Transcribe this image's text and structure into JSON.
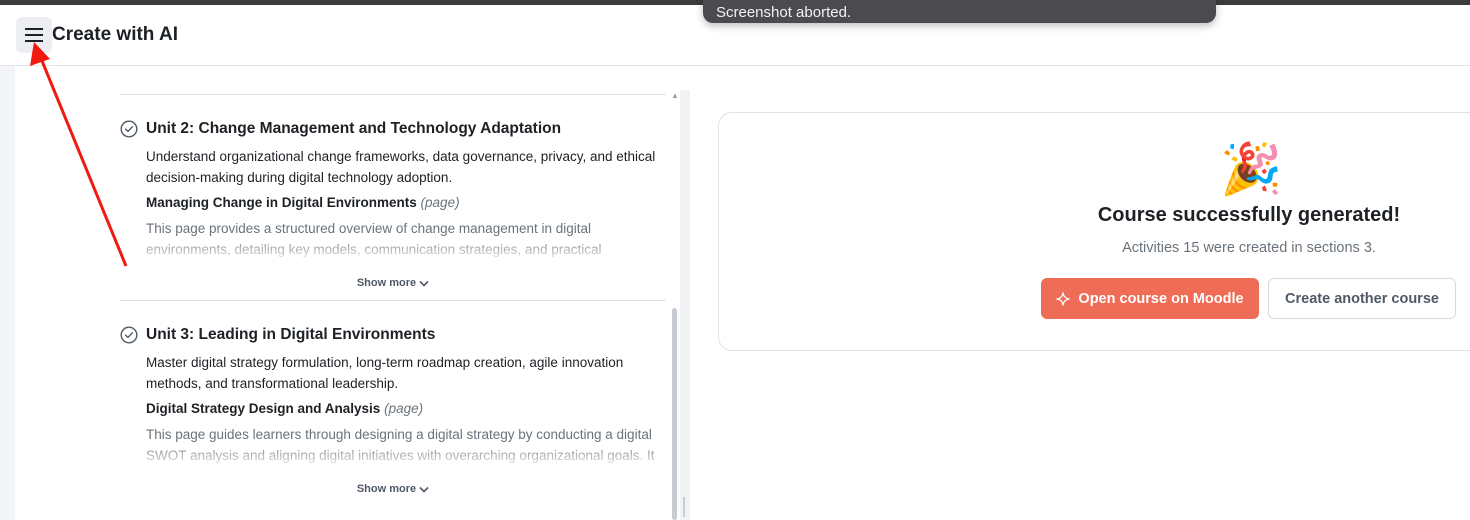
{
  "toast": {
    "text": "Screenshot aborted."
  },
  "header": {
    "title": "Create with AI",
    "menu_icon": "hamburger-menu-icon"
  },
  "units": [
    {
      "title": "Unit 2: Change Management and Technology Adaptation",
      "description": "Understand organizational change frameworks, data governance, privacy, and ethical decision-making during digital technology adoption.",
      "activity": {
        "name": "Managing Change in Digital Environments",
        "type": "(page)",
        "description": "This page provides a structured overview of change management in digital environments, detailing key models, communication strategies, and practical"
      },
      "show_more": "Show more"
    },
    {
      "title": "Unit 3: Leading in Digital Environments",
      "description": "Master digital strategy formulation, long-term roadmap creation, agile innovation methods, and transformational leadership.",
      "activity": {
        "name": "Digital Strategy Design and Analysis",
        "type": "(page)",
        "description": "This page guides learners through designing a digital strategy by conducting a digital SWOT analysis and aligning digital initiatives with overarching organizational goals. It"
      },
      "show_more": "Show more"
    }
  ],
  "result": {
    "icon": "party-popper-icon",
    "emoji": "🎉",
    "title": "Course successfully generated!",
    "subtitle": "Activities 15 were created in sections 3.",
    "primary_button": "Open course on Moodle",
    "secondary_button": "Create another course"
  },
  "colors": {
    "accent": "#ef6d57",
    "annotation_arrow": "#f01a10",
    "header_divider": "#e3e5e8"
  }
}
